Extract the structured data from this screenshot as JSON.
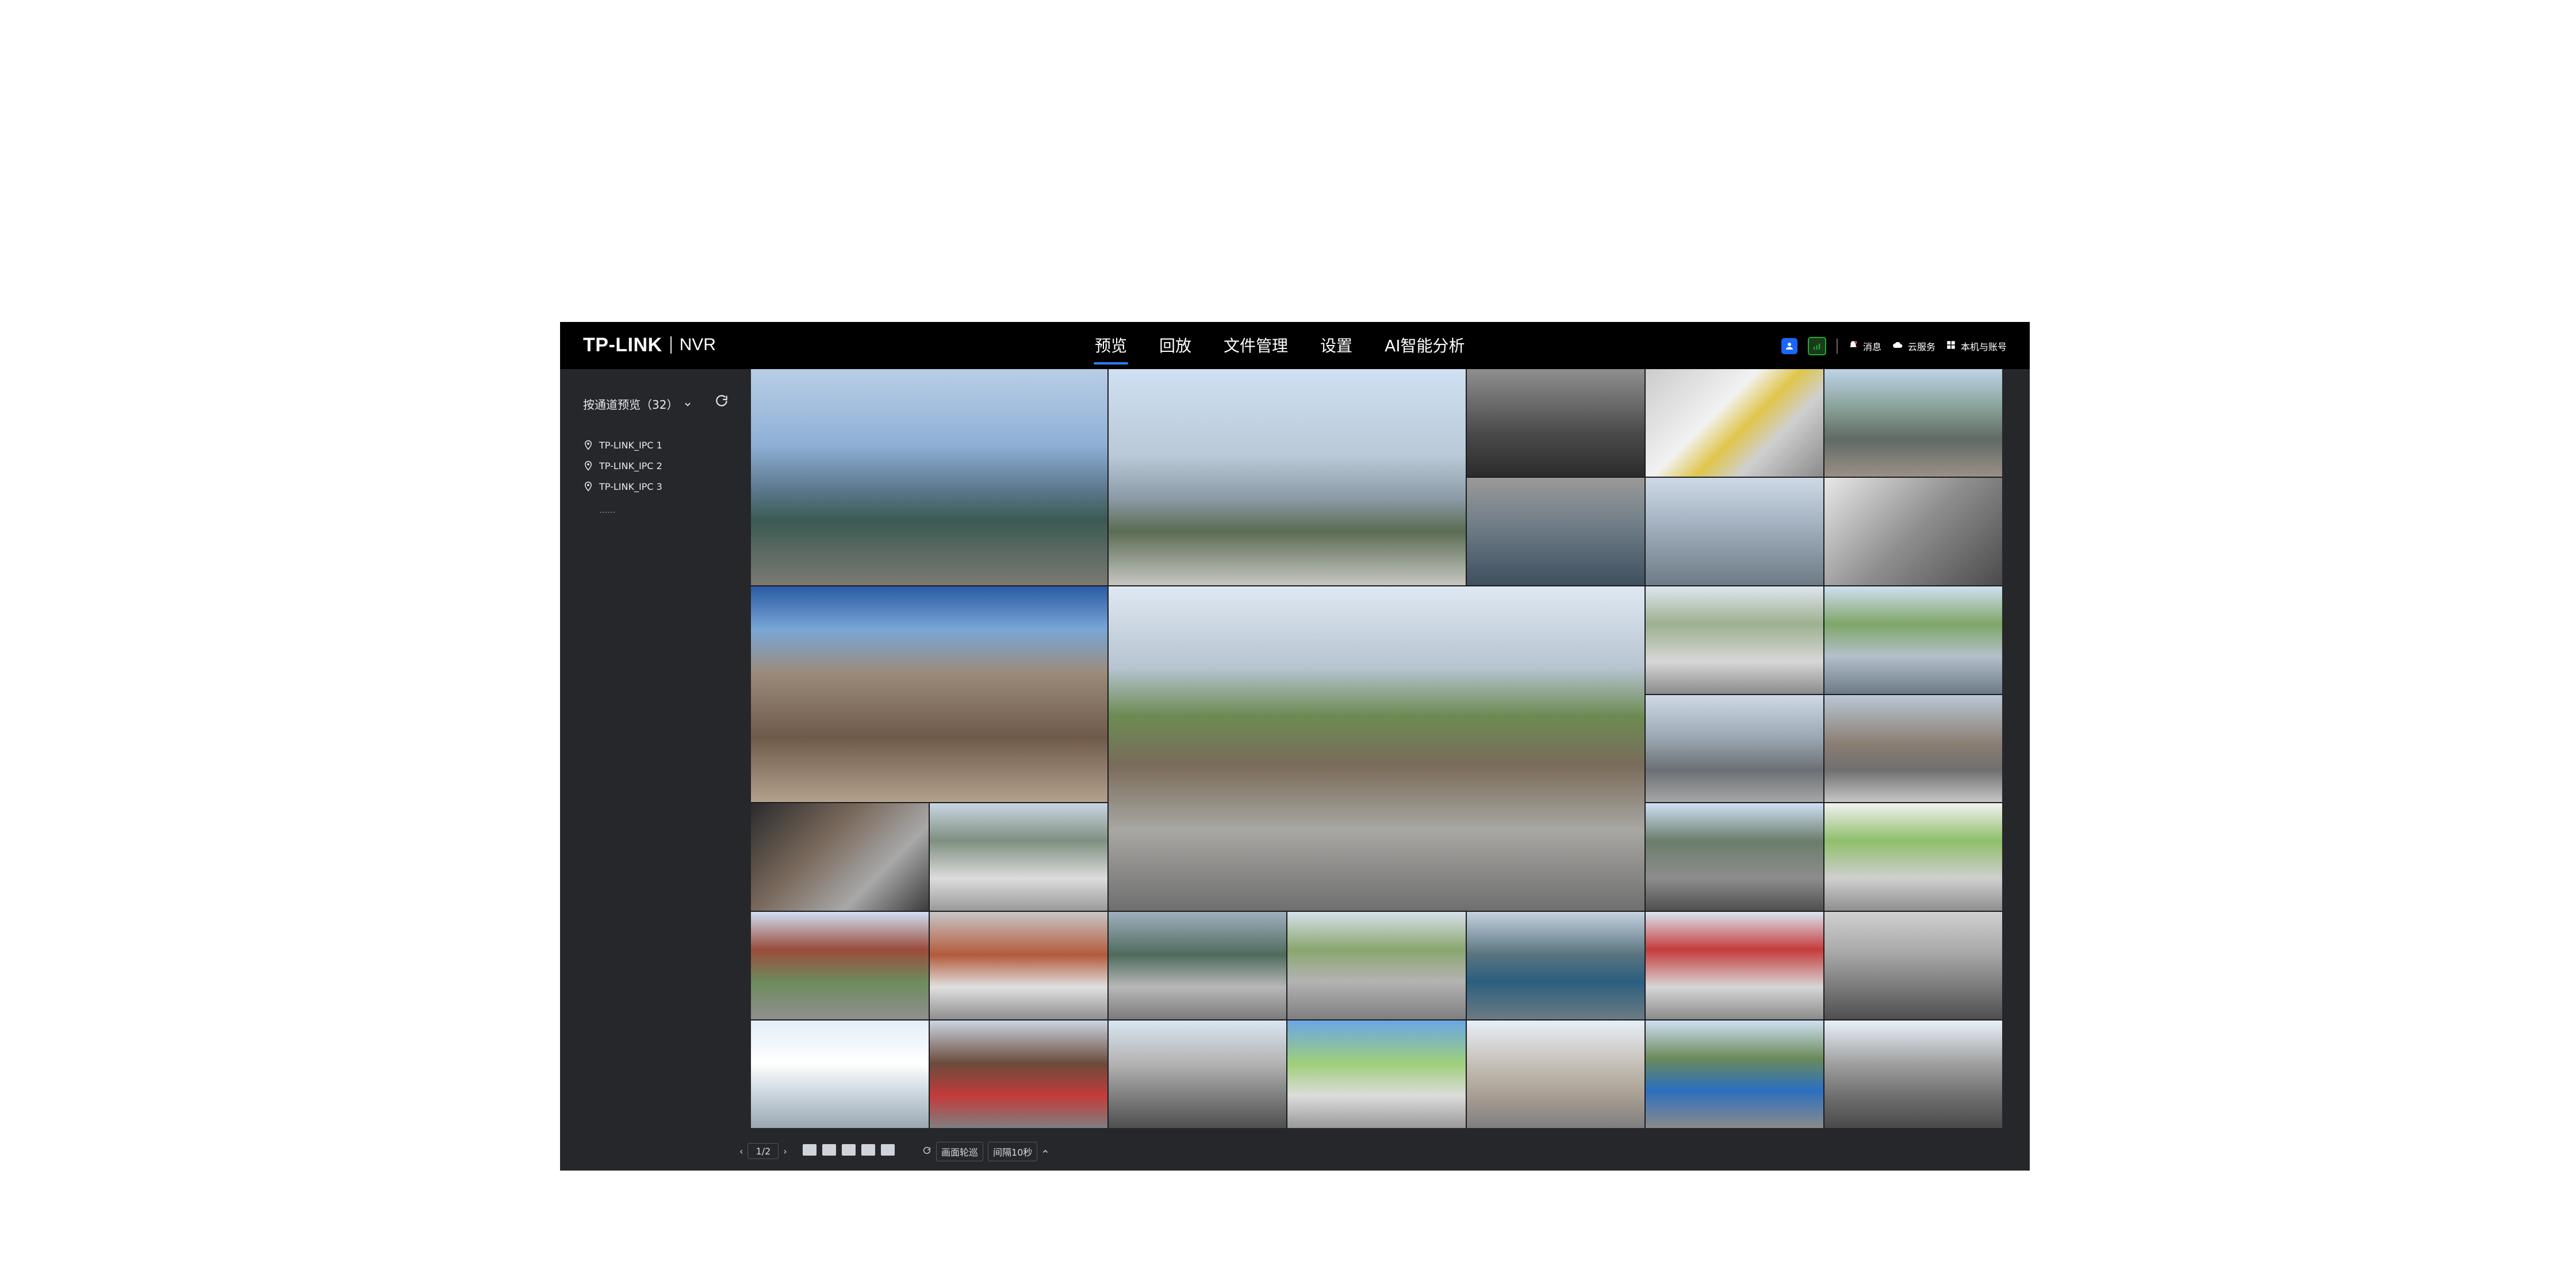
{
  "app": {
    "brand": "TP-LINK",
    "product": "NVR"
  },
  "nav": {
    "tabs": [
      "预览",
      "回放",
      "文件管理",
      "设置",
      "AI智能分析"
    ],
    "active": "预览"
  },
  "header_right": {
    "messages_label": "消息",
    "cloud_label": "云服务",
    "account_label": "本机与账号"
  },
  "sidebar": {
    "channel_filter_label": "按通道预览（32）",
    "channels": [
      "TP-LINK_IPC 1",
      "TP-LINK_IPC 2",
      "TP-LINK_IPC 3"
    ],
    "more": "……"
  },
  "bottom": {
    "page_indicator": "1/2",
    "poll_label": "画面轮巡",
    "interval_label": "间隔10秒"
  },
  "colors": {
    "accent": "#2f7cff",
    "header_bg": "#000000",
    "panel_bg": "#26272a"
  },
  "icons": [
    "refresh-icon",
    "map-pin-icon",
    "cloud-icon",
    "grid-icon",
    "user-icon",
    "signal-icon"
  ]
}
